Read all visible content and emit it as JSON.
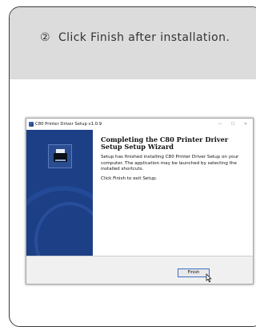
{
  "instruction": {
    "step_number": "②",
    "text": "Click Finish after installation."
  },
  "window": {
    "title": "C80 Printer Driver Setup v1.0.9",
    "minimize_glyph": "—",
    "maximize_glyph": "☐",
    "close_glyph": "✕",
    "heading": "Completing the C80 Printer Driver Setup Setup Wizard",
    "body_1": "Setup has finished installing C80 Printer Driver Setup on your computer. The application may be launched by selecting the installed shortcuts.",
    "body_2": "Click Finish to exit Setup.",
    "finish_button": "Finish"
  }
}
